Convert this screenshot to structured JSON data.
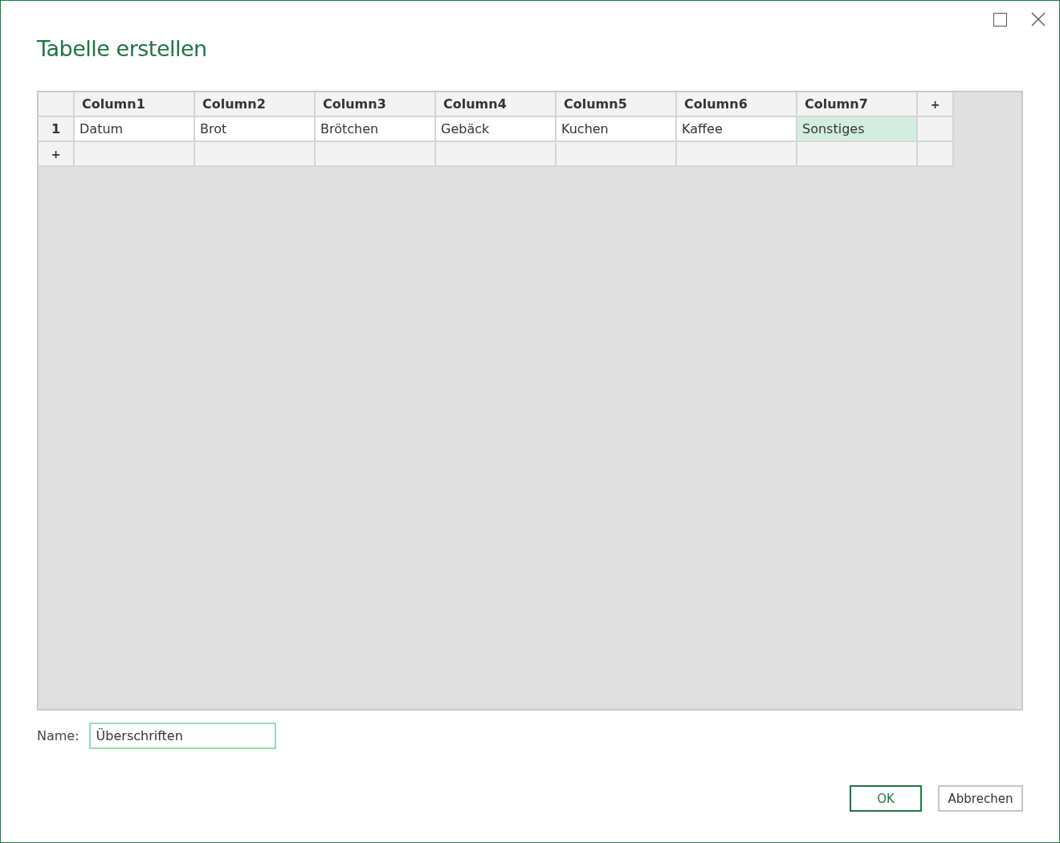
{
  "window": {
    "title": "Tabelle erstellen"
  },
  "table": {
    "columns": [
      "Column1",
      "Column2",
      "Column3",
      "Column4",
      "Column5",
      "Column6",
      "Column7"
    ],
    "add_column": "+",
    "rows": [
      {
        "number": "1",
        "cells": [
          {
            "text": "Datum",
            "selected": false
          },
          {
            "text": "Brot",
            "selected": false
          },
          {
            "text": "Brötchen",
            "selected": false
          },
          {
            "text": "Gebäck",
            "selected": false
          },
          {
            "text": "Kuchen",
            "selected": false
          },
          {
            "text": "Kaffee",
            "selected": false
          },
          {
            "text": "Sonstiges",
            "selected": true
          }
        ]
      }
    ],
    "add_row": "+"
  },
  "name": {
    "label": "Name:",
    "value": "Überschriften"
  },
  "buttons": [
    {
      "label": "OK",
      "primary": true
    },
    {
      "label": "Abbrechen",
      "primary": false
    }
  ]
}
